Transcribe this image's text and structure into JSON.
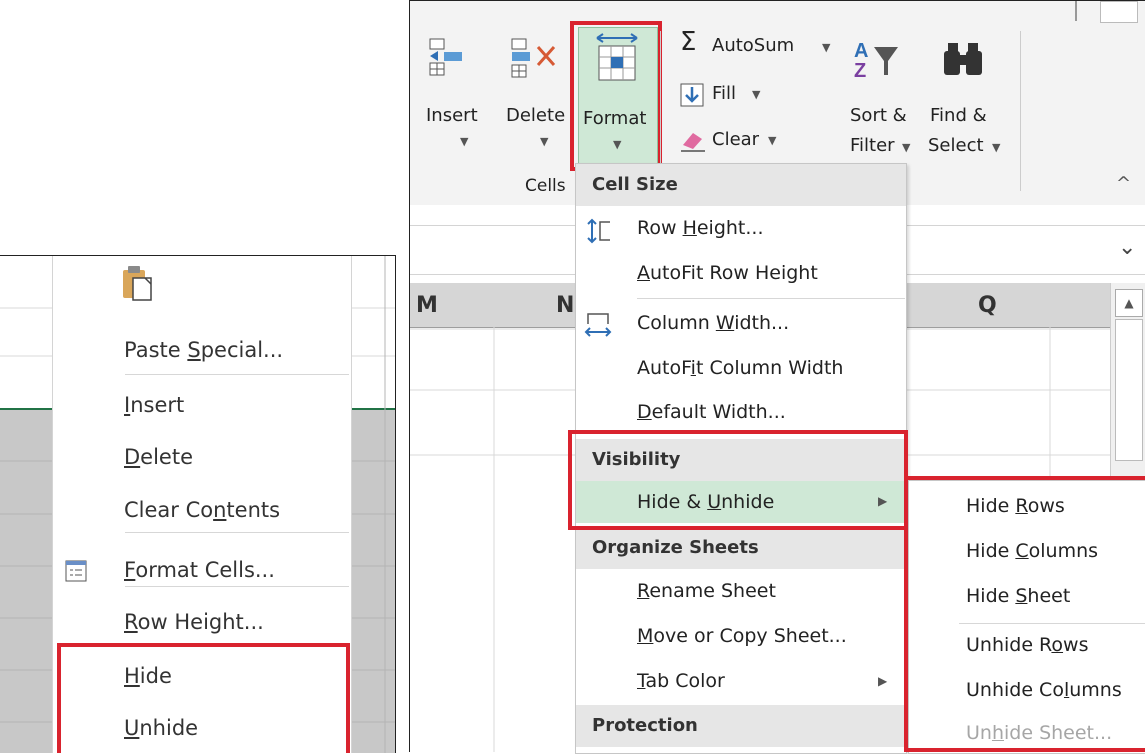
{
  "left_context_menu": {
    "items": [
      {
        "pre": "Paste ",
        "ul": "S",
        "post": "pecial..."
      },
      {
        "pre": "",
        "ul": "I",
        "post": "nsert"
      },
      {
        "pre": "",
        "ul": "D",
        "post": "elete"
      },
      {
        "pre": "Clear Co",
        "ul": "n",
        "post": "tents"
      },
      {
        "pre": "",
        "ul": "F",
        "post": "ormat Cells..."
      },
      {
        "pre": "",
        "ul": "R",
        "post": "ow Height..."
      },
      {
        "pre": "",
        "ul": "H",
        "post": "ide"
      },
      {
        "pre": "",
        "ul": "U",
        "post": "nhide"
      }
    ]
  },
  "ribbon": {
    "insert_label": "Insert",
    "delete_label": "Delete",
    "format_label": "Format",
    "autosum_label": "AutoSum",
    "fill_label": "Fill",
    "clear_label": "Clear",
    "sort_label_1": "Sort &",
    "sort_label_2": "Filter",
    "find_label_1": "Find &",
    "find_label_2": "Select",
    "group_cells": "Cells",
    "autosum_symbol": "Σ"
  },
  "sheet": {
    "columns": [
      "M",
      "N",
      "Q"
    ]
  },
  "format_menu": {
    "head_cell_size": "Cell Size",
    "row_height": {
      "pre": "Row ",
      "ul": "H",
      "post": "eight..."
    },
    "autofit_row": {
      "pre": "",
      "ul": "A",
      "post": "utoFit Row Height"
    },
    "column_width": {
      "pre": "Column ",
      "ul": "W",
      "post": "idth..."
    },
    "autofit_col": {
      "pre": "AutoF",
      "ul": "i",
      "post": "t Column Width"
    },
    "default_width": {
      "pre": "",
      "ul": "D",
      "post": "efault Width..."
    },
    "head_visibility": "Visibility",
    "hide_unhide": {
      "pre": "Hide & ",
      "ul": "U",
      "post": "nhide"
    },
    "head_organize": "Organize Sheets",
    "rename_sheet": {
      "pre": "",
      "ul": "R",
      "post": "ename Sheet"
    },
    "move_copy": {
      "pre": "",
      "ul": "M",
      "post": "ove or Copy Sheet..."
    },
    "tab_color": {
      "pre": "",
      "ul": "T",
      "post": "ab Color"
    },
    "head_protection": "Protection"
  },
  "submenu": {
    "hide_rows": {
      "pre": "Hide ",
      "ul": "R",
      "post": "ows"
    },
    "hide_columns": {
      "pre": "Hide ",
      "ul": "C",
      "post": "olumns"
    },
    "hide_sheet": {
      "pre": "Hide ",
      "ul": "S",
      "post": "heet"
    },
    "unhide_rows": {
      "pre": "Unhide R",
      "ul": "o",
      "post": "ws"
    },
    "unhide_columns": {
      "pre": "Unhide Co",
      "ul": "l",
      "post": "umns"
    },
    "unhide_sheet": {
      "pre": "Un",
      "ul": "h",
      "post": "ide Sheet..."
    }
  },
  "colors": {
    "highlight_red": "#d9232e",
    "menu_hover_green": "#cfe8d6",
    "excel_green": "#217346"
  }
}
